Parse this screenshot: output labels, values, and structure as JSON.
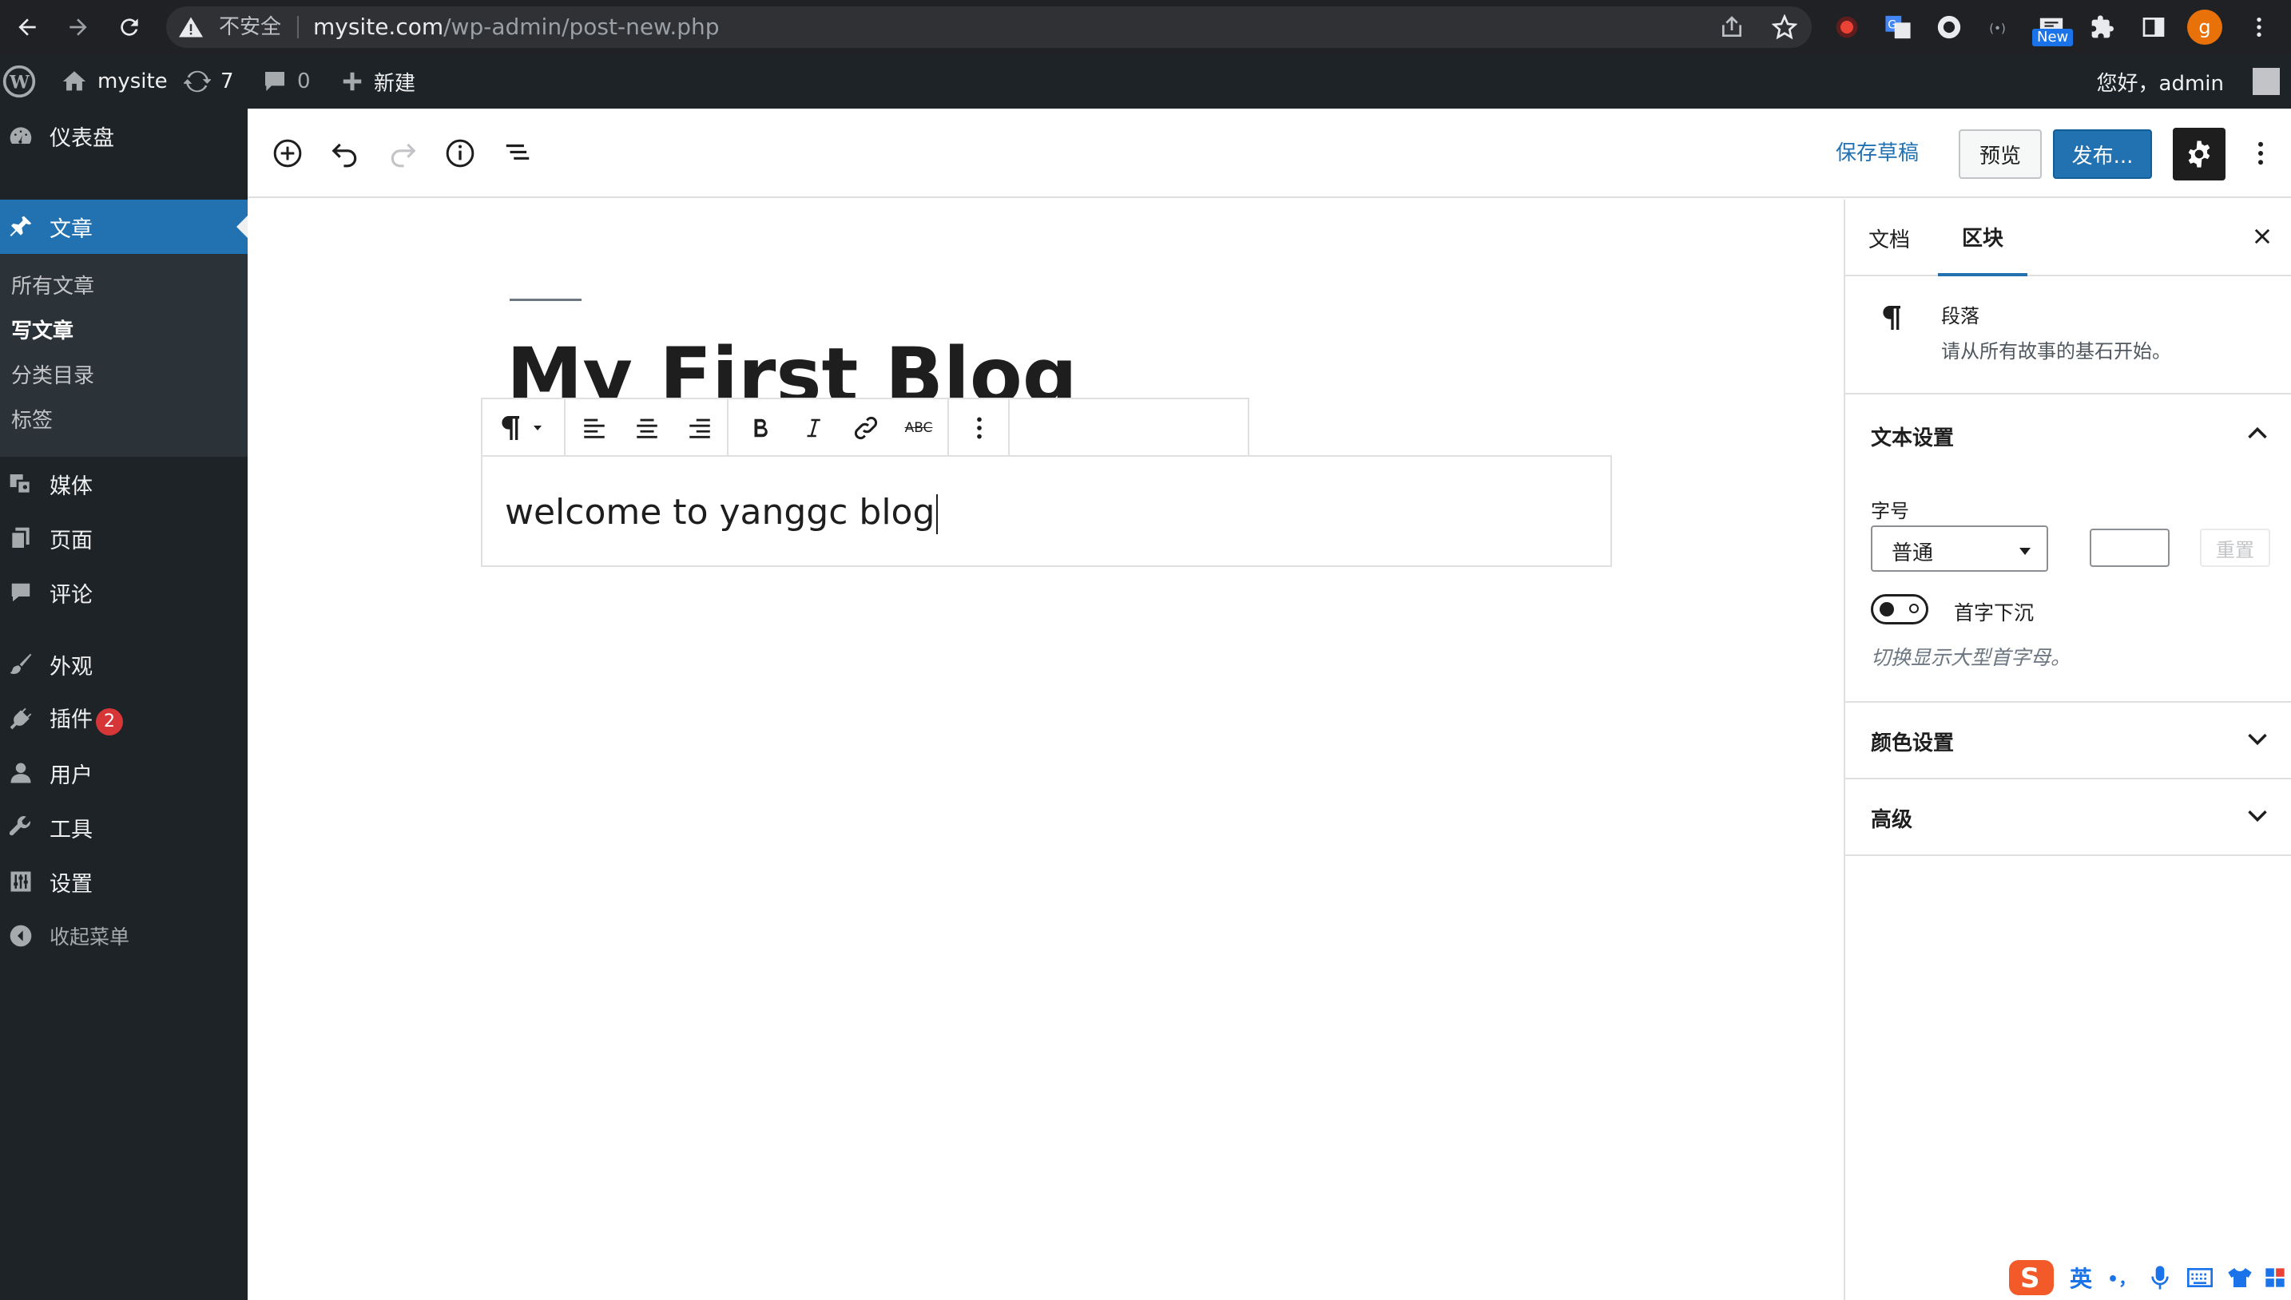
{
  "browser": {
    "insecure_label": "不安全",
    "url_host": "mysite.com",
    "url_path": "/wp-admin/post-new.php",
    "ext_new_badge": "New",
    "profile_initial": "g"
  },
  "adminbar": {
    "site_name": "mysite",
    "updates_count": "7",
    "comments_count": "0",
    "new_label": "新建",
    "greeting": "您好，admin"
  },
  "menu": {
    "dashboard": "仪表盘",
    "posts": "文章",
    "submenu": [
      "所有文章",
      "写文章",
      "分类目录",
      "标签"
    ],
    "media": "媒体",
    "pages": "页面",
    "comments": "评论",
    "appearance": "外观",
    "plugins": "插件",
    "plugins_badge": "2",
    "users": "用户",
    "tools": "工具",
    "settings": "设置",
    "collapse": "收起菜单"
  },
  "editor": {
    "save_draft": "保存草稿",
    "preview": "预览",
    "publish": "发布...",
    "title": "My First Blog",
    "paragraph": "welcome to yanggc blog",
    "toolbar_strikethrough": "ABC"
  },
  "settings": {
    "tab_document": "文档",
    "tab_block": "区块",
    "block_name": "段落",
    "block_desc": "请从所有故事的基石开始。",
    "text_settings": "文本设置",
    "font_size_label": "字号",
    "font_size_value": "普通",
    "reset_label": "重置",
    "dropcap_label": "首字下沉",
    "dropcap_help": "切换显示大型首字母。",
    "color_settings": "颜色设置",
    "advanced": "高级"
  },
  "ime": {
    "lang": "英",
    "punct": "•，"
  },
  "colors": {
    "accent": "#2271b1",
    "admin_dark": "#1d2327",
    "chrome_dark": "#202124"
  }
}
